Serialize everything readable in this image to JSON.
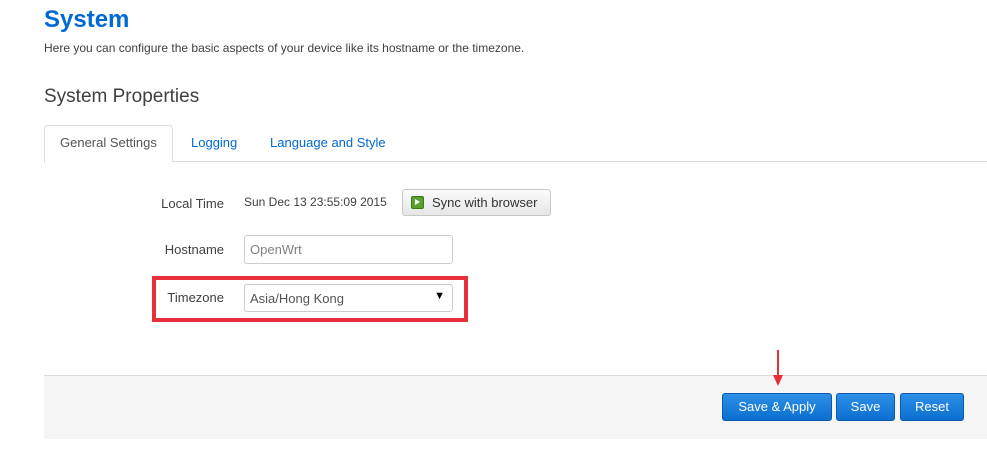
{
  "page": {
    "title": "System",
    "description": "Here you can configure the basic aspects of your device like its hostname or the timezone."
  },
  "section": {
    "title": "System Properties"
  },
  "tabs": [
    {
      "label": "General Settings",
      "active": true
    },
    {
      "label": "Logging",
      "active": false
    },
    {
      "label": "Language and Style",
      "active": false
    }
  ],
  "form": {
    "local_time": {
      "label": "Local Time",
      "value": "Sun Dec 13 23:55:09 2015",
      "sync_button": "Sync with browser",
      "sync_icon": "play-icon"
    },
    "hostname": {
      "label": "Hostname",
      "value": "OpenWrt"
    },
    "timezone": {
      "label": "Timezone",
      "value": "Asia/Hong Kong"
    }
  },
  "footer": {
    "save_apply": "Save & Apply",
    "save": "Save",
    "reset": "Reset"
  },
  "annotations": {
    "highlight_color": "#e8303b"
  },
  "colors": {
    "accent": "#0069d6",
    "button": "#0b6fd0"
  }
}
